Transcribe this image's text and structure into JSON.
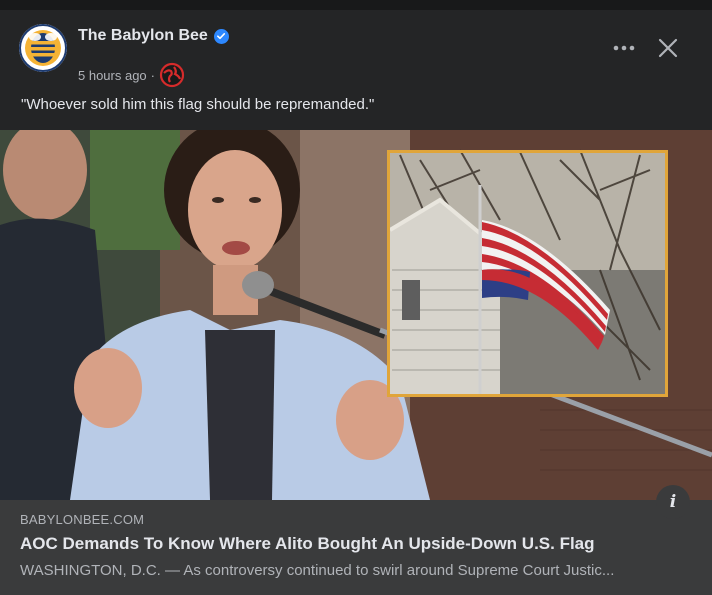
{
  "post": {
    "author": "The Babylon Bee",
    "timestamp": "5 hours ago",
    "separator": "·",
    "caption": "\"Whoever sold him this flag should be repremanded.\""
  },
  "header": {
    "more_label": "•••",
    "close_label": "✕"
  },
  "media": {
    "info_label": "i"
  },
  "link_preview": {
    "domain": "BABYLONBEE.COM",
    "headline": "AOC Demands To Know Where Alito Bought An Upside-Down U.S. Flag",
    "description": "WASHINGTON, D.C. — As controversy continued to swirl around Supreme Court Justic..."
  },
  "colors": {
    "card_bg": "#242526",
    "link_bg": "#3a3b3c",
    "verified": "#2d88ff",
    "inset_border": "#e0a53a"
  },
  "icons": [
    "babylon-bee-logo-icon",
    "verified-badge-icon",
    "globe-icon",
    "more-options-icon",
    "close-icon",
    "info-icon"
  ]
}
